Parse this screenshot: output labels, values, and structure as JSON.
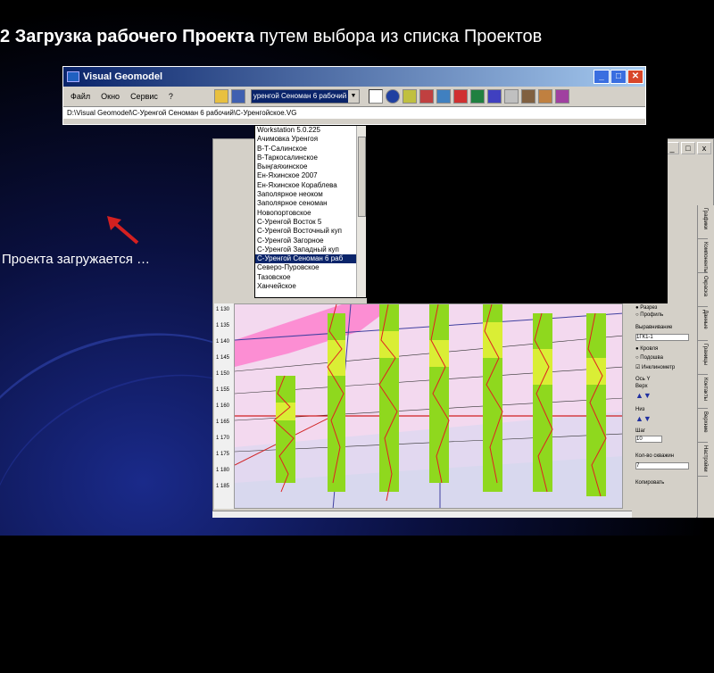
{
  "slide": {
    "title_num": "2",
    "title_bold": "Загрузка рабочего Проекта",
    "title_rest": "путем выбора из списка Проектов",
    "caption": "Проекта загружается …"
  },
  "window": {
    "title": "Visual Geomodel",
    "menu": [
      "Файл",
      "Окно",
      "Сервис",
      "?"
    ],
    "combo_value": "уренгой Сеноман 6 рабочий",
    "path": "D:\\Visual Geomodel\\С-Уренгой Сеноман 6 рабочий\\С-Уренгойское.VG"
  },
  "dropdown": {
    "items": [
      "Workstation 5.0.225",
      "Ачимовка Уренгоя",
      "В-Т-Салинское",
      "В-Таркосалинское",
      "Выңгаяхинское",
      "Ен-Яхинское 2007",
      "Ен-Яхинское Кораблева",
      "Заполярное неоком",
      "Заполярное сеноман",
      "Новопортовское",
      "С-Уренгой Восток 5",
      "С-Уренгой Восточный куп",
      "С-Уренгой Загорное",
      "С-Уренгой Западный куп",
      "С-Уренгой Сеноман 6 раб",
      "Северо-Пуровское",
      "Тазовское",
      "Ханчейское"
    ],
    "selected_index": 14
  },
  "depth_ruler": [
    "1 130",
    "1 135",
    "1 140",
    "1 145",
    "1 150",
    "1 155",
    "1 160",
    "1 165",
    "1 170",
    "1 175",
    "1 180",
    "1 185"
  ],
  "side_panel": {
    "radio1": "Разрез",
    "radio2": "Профиль",
    "section_align": "Выравнивание",
    "align_value": "1ГК1-1",
    "opt_top": "Кровля",
    "opt_bottom": "Подошва",
    "opt_inclin": "Инклинометр",
    "axis_y": "Ось Y",
    "up": "Верх",
    "down": "Низ",
    "step": "Шаг",
    "step_value": "10",
    "wells_count": "Кол-во скважин",
    "wells_value": "7",
    "copy": "Копировать"
  },
  "side_tabs": [
    "Графики",
    "Компоненты",
    "Окраска",
    "Данные",
    "Границы",
    "Контакты",
    "Верхние",
    "Настройки"
  ]
}
